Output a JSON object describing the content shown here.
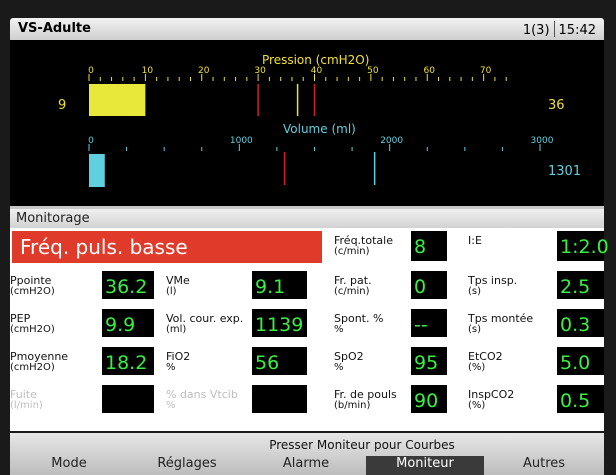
{
  "header": {
    "title": "VS-Adulte",
    "page": "1(3)",
    "time": "15:42"
  },
  "pressure": {
    "title": "Pression (cmH2O)",
    "left_value": "9",
    "right_value": "36",
    "fill_value": 10,
    "scale_min": 0,
    "scale_max": 80,
    "ticks": [
      "0",
      "10",
      "20",
      "30",
      "40",
      "50",
      "60",
      "70"
    ],
    "marker_red_1": 30,
    "marker_yellow": 37,
    "marker_red_2": 40,
    "fill_color": "#e8e83a",
    "accent": "#f0e030"
  },
  "volume": {
    "title": "Volume (ml)",
    "right_value": "1301",
    "fill_value": 105,
    "scale_min": 0,
    "scale_max": 3000,
    "ticks": [
      "0",
      "1000",
      "2000",
      "3000"
    ],
    "marker_red": 1301,
    "marker_cyan": 1900,
    "fill_color": "#5fd0e0",
    "accent": "#5fd0e0"
  },
  "monitor": {
    "title": "Monitorage",
    "alarm": "Fréq. puls. basse",
    "alarm_color": "#e03a2a",
    "cells": {
      "freq_totale": {
        "label": "Fréq.totale",
        "unit": "(c/min)",
        "value": "8"
      },
      "ie": {
        "label": "I:E",
        "unit": "",
        "value": "1:2.0"
      },
      "ppointe": {
        "label": "Ppointe",
        "unit": "(cmH2O)",
        "value": "36.2"
      },
      "vme": {
        "label": "VMe",
        "unit": "(l)",
        "value": "9.1"
      },
      "fr_pat": {
        "label": "Fr. pat.",
        "unit": "(c/min)",
        "value": "0"
      },
      "tps_insp": {
        "label": "Tps insp.",
        "unit": "(s)",
        "value": "2.5"
      },
      "pep": {
        "label": "PEP",
        "unit": "(cmH2O)",
        "value": "9.9"
      },
      "vol_cour": {
        "label": "Vol. cour. exp.",
        "unit": "(ml)",
        "value": "1139"
      },
      "spont": {
        "label": "Spont. %",
        "unit": "%",
        "value": "--"
      },
      "tps_montee": {
        "label": "Tps montée",
        "unit": "(s)",
        "value": "0.3"
      },
      "pmoyenne": {
        "label": "Pmoyenne",
        "unit": "(cmH2O)",
        "value": "18.2"
      },
      "fio2": {
        "label": "FiO2",
        "unit": "%",
        "value": "56"
      },
      "spo2": {
        "label": "SpO2",
        "unit": "%",
        "value": "95"
      },
      "etco2": {
        "label": "EtCO2",
        "unit": "(%)",
        "value": "5.0"
      },
      "fuite": {
        "label": "Fuite",
        "unit": "(l/min)",
        "value": ""
      },
      "pct_vtcib": {
        "label": "% dans Vtcib",
        "unit": "%",
        "value": ""
      },
      "fr_pouls": {
        "label": "Fr. de pouls",
        "unit": "(b/min)",
        "value": "90"
      },
      "inspco2": {
        "label": "InspCO2",
        "unit": "(%)",
        "value": "0.5"
      }
    }
  },
  "footer": {
    "hint": "Presser Moniteur pour Courbes",
    "menu": [
      "Mode",
      "Réglages",
      "Alarme",
      "Moniteur",
      "Autres"
    ],
    "active_index": 3
  }
}
